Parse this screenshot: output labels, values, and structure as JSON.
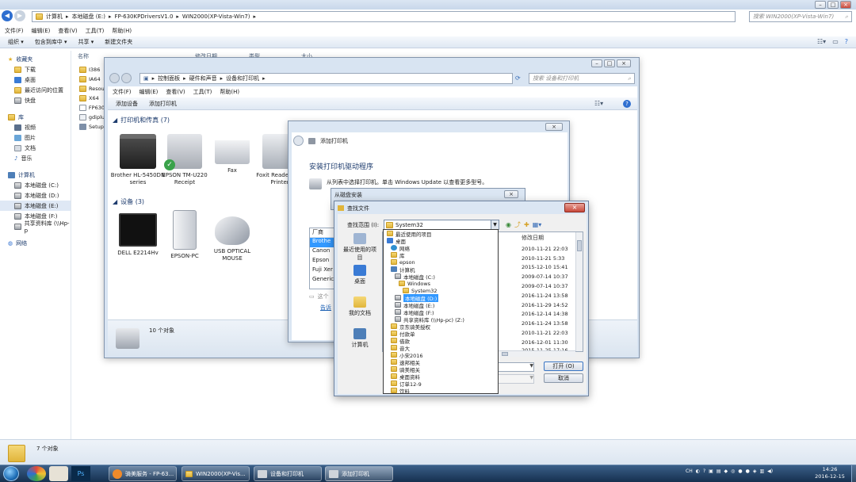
{
  "explorer": {
    "breadcrumb": [
      "计算机",
      "本地磁盘 (E:)",
      "FP-630KPDriversV1.0",
      "WIN2000(XP-Vista-Win7)"
    ],
    "search_placeholder": "搜索 WIN2000(XP-Vista-Win7)",
    "menu": [
      "文件(F)",
      "编辑(E)",
      "查看(V)",
      "工具(T)",
      "帮助(H)"
    ],
    "toolbar": [
      "组织 ▾",
      "包含到库中 ▾",
      "共享 ▾",
      "新建文件夹"
    ],
    "columns": [
      "名称",
      "修改日期",
      "类型",
      "大小"
    ],
    "files": [
      "I386",
      "IA64",
      "Resou",
      "X64",
      "FP630",
      "gdiplu",
      "Setup"
    ],
    "status": "7 个对象",
    "nav": {
      "favorites": {
        "title": "收藏夹",
        "items": [
          "下载",
          "桌面",
          "最近访问的位置",
          "快盘"
        ]
      },
      "libraries": {
        "title": "库",
        "items": [
          "视频",
          "图片",
          "文档",
          "音乐"
        ]
      },
      "computer": {
        "title": "计算机",
        "items": [
          "本地磁盘 (C:)",
          "本地磁盘 (D:)",
          "本地磁盘 (E:)",
          "本地磁盘 (F:)",
          "共享资料库 (\\\\Hp-p"
        ]
      },
      "network": "网络"
    }
  },
  "devices_window": {
    "breadcrumb": [
      "控制面板",
      "硬件和声音",
      "设备和打印机"
    ],
    "search_placeholder": "搜索 设备和打印机",
    "menu": [
      "文件(F)",
      "编辑(E)",
      "查看(V)",
      "工具(T)",
      "帮助(H)"
    ],
    "toolbar": [
      "添加设备",
      "添加打印机"
    ],
    "printers_header": "打印机和传真 (7)",
    "printers": [
      {
        "name": "Brother HL-5450DN series"
      },
      {
        "name": "EPSON TM-U220 Receipt"
      },
      {
        "name": "Fax"
      },
      {
        "name": "Foxit Reader PDF Printer"
      }
    ],
    "devices_header": "设备 (3)",
    "devices": [
      {
        "name": "DELL E2214Hv"
      },
      {
        "name": "EPSON-PC"
      },
      {
        "name": "USB OPTICAL MOUSE"
      }
    ],
    "status": "10 个对象"
  },
  "add_printer": {
    "title": "添加打印机",
    "heading": "安装打印机驱动程序",
    "description": "从列表中选择打印机。单击 Windows Update 以查看更多型号。",
    "manufacturer_header": "厂商",
    "manufacturers": [
      "Brothe",
      "Canon",
      "Epson",
      "Fuji Xer",
      "Generic"
    ],
    "note": "这个",
    "link": "告诉"
  },
  "install_from_disk": {
    "title": "从磁盘安装"
  },
  "find_file": {
    "title": "查找文件",
    "lookin_label": "查找范围 (I):",
    "lookin_value": "System32",
    "places": [
      "最近使用的项目",
      "桌面",
      "我的文档",
      "计算机"
    ],
    "date_header": "修改日期",
    "dates": [
      "2010-11-21 22:03",
      "2010-11-21 5:33",
      "2015-12-10 15:41",
      "2009-07-14 10:37",
      "2009-07-14 10:37",
      "2016-11-24 13:58",
      "2016-11-29 14:52",
      "2016-12-14 14:38",
      "2016-11-24 13:58",
      "2010-11-21 22:03",
      "2016-12-01 11:30",
      "2015-11-25 17:16"
    ],
    "open_button": "打开 (O)",
    "cancel_button": "取消",
    "dropdown": [
      {
        "label": "最近使用的项目",
        "indent": 0,
        "icon": "folder"
      },
      {
        "label": "桌面",
        "indent": 0,
        "icon": "desktop"
      },
      {
        "label": "网络",
        "indent": 1,
        "icon": "network"
      },
      {
        "label": "库",
        "indent": 1,
        "icon": "folder"
      },
      {
        "label": "epson",
        "indent": 1,
        "icon": "folder"
      },
      {
        "label": "计算机",
        "indent": 1,
        "icon": "computer"
      },
      {
        "label": "本地磁盘 (C:)",
        "indent": 2,
        "icon": "drive"
      },
      {
        "label": "Windows",
        "indent": 3,
        "icon": "folder"
      },
      {
        "label": "System32",
        "indent": 4,
        "icon": "folder"
      },
      {
        "label": "本地磁盘 (D:)",
        "indent": 2,
        "icon": "drive",
        "selected": true
      },
      {
        "label": "本地磁盘 (E:)",
        "indent": 2,
        "icon": "drive"
      },
      {
        "label": "本地磁盘 (F:)",
        "indent": 2,
        "icon": "drive"
      },
      {
        "label": "共享资料库 (\\\\Hp-pc) (Z:)",
        "indent": 2,
        "icon": "drive"
      },
      {
        "label": "京东骑美授权",
        "indent": 1,
        "icon": "folder"
      },
      {
        "label": "付款单",
        "indent": 1,
        "icon": "folder"
      },
      {
        "label": "借款",
        "indent": 1,
        "icon": "folder"
      },
      {
        "label": "音大",
        "indent": 1,
        "icon": "folder"
      },
      {
        "label": "小宋2016",
        "indent": 1,
        "icon": "folder"
      },
      {
        "label": "速邦相关",
        "indent": 1,
        "icon": "folder"
      },
      {
        "label": "骑美相关",
        "indent": 1,
        "icon": "folder"
      },
      {
        "label": "桌面资料",
        "indent": 1,
        "icon": "folder"
      },
      {
        "label": "订单12-9",
        "indent": 1,
        "icon": "folder"
      },
      {
        "label": "饮料",
        "indent": 1,
        "icon": "folder"
      }
    ]
  },
  "taskbar": {
    "buttons": [
      "骑美服务 - FP-63...",
      "WIN2000(XP-Vis...",
      "设备和打印机",
      "添加打印机"
    ],
    "tray_lang": "CH",
    "time": "14:26",
    "date": "2016-12-15"
  },
  "colors": {
    "accent": "#3399ff",
    "selection": "#3399ff",
    "taskbar": "#1e3a5c"
  }
}
